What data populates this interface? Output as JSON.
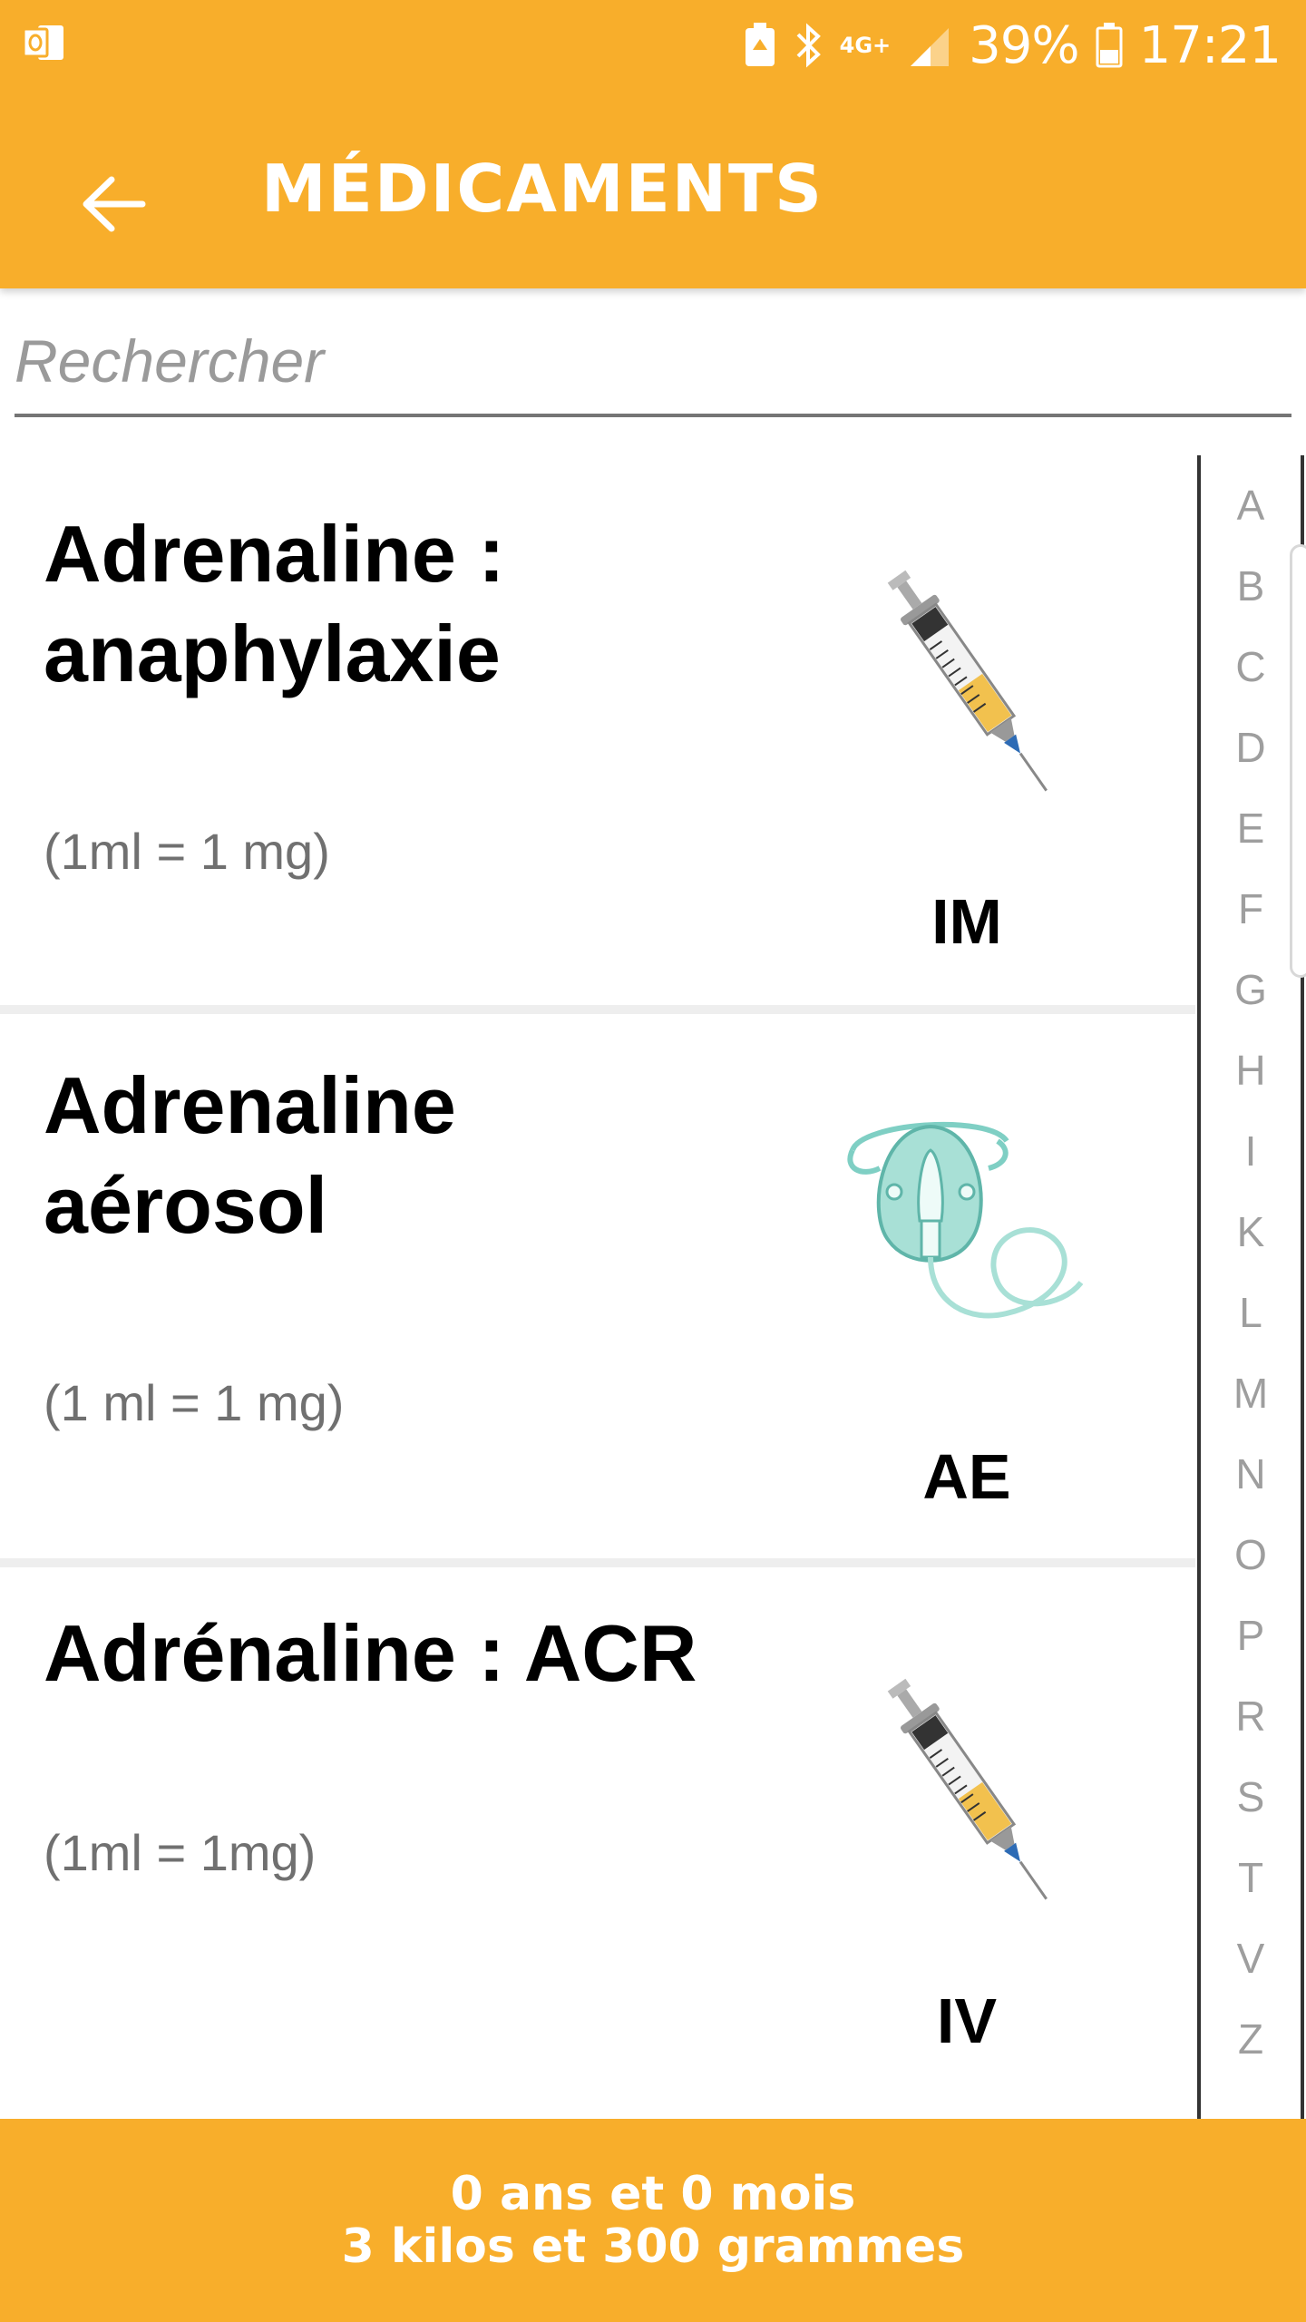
{
  "status_bar": {
    "network": "4G+",
    "battery": "39%",
    "time": "17:21"
  },
  "header": {
    "title": "MÉDICAMENTS"
  },
  "search": {
    "placeholder": "Rechercher",
    "value": ""
  },
  "medications": [
    {
      "title_line1": "Adrenaline :",
      "title_line2": "anaphylaxie",
      "concentration": "(1ml = 1 mg)",
      "route": "IM",
      "icon": "syringe-icon"
    },
    {
      "title_line1": "Adrenaline",
      "title_line2": "aérosol",
      "concentration": "(1 ml = 1 mg)",
      "route": "AE",
      "icon": "nebulizer-mask-icon"
    },
    {
      "title_line1": "Adrénaline : ACR",
      "title_line2": "",
      "concentration": "(1ml = 1mg)",
      "route": "IV",
      "icon": "syringe-icon"
    }
  ],
  "alpha_index": [
    "A",
    "B",
    "C",
    "D",
    "E",
    "F",
    "G",
    "H",
    "I",
    "K",
    "L",
    "M",
    "N",
    "O",
    "P",
    "R",
    "S",
    "T",
    "V",
    "Z"
  ],
  "footer": {
    "age": "0 ans et 0 mois",
    "weight": "3 kilos et 300 grammes"
  },
  "colors": {
    "primary": "#f8ae2b",
    "text": "#000000",
    "subtext": "#707070",
    "index_letters": "#9e9e9e"
  }
}
